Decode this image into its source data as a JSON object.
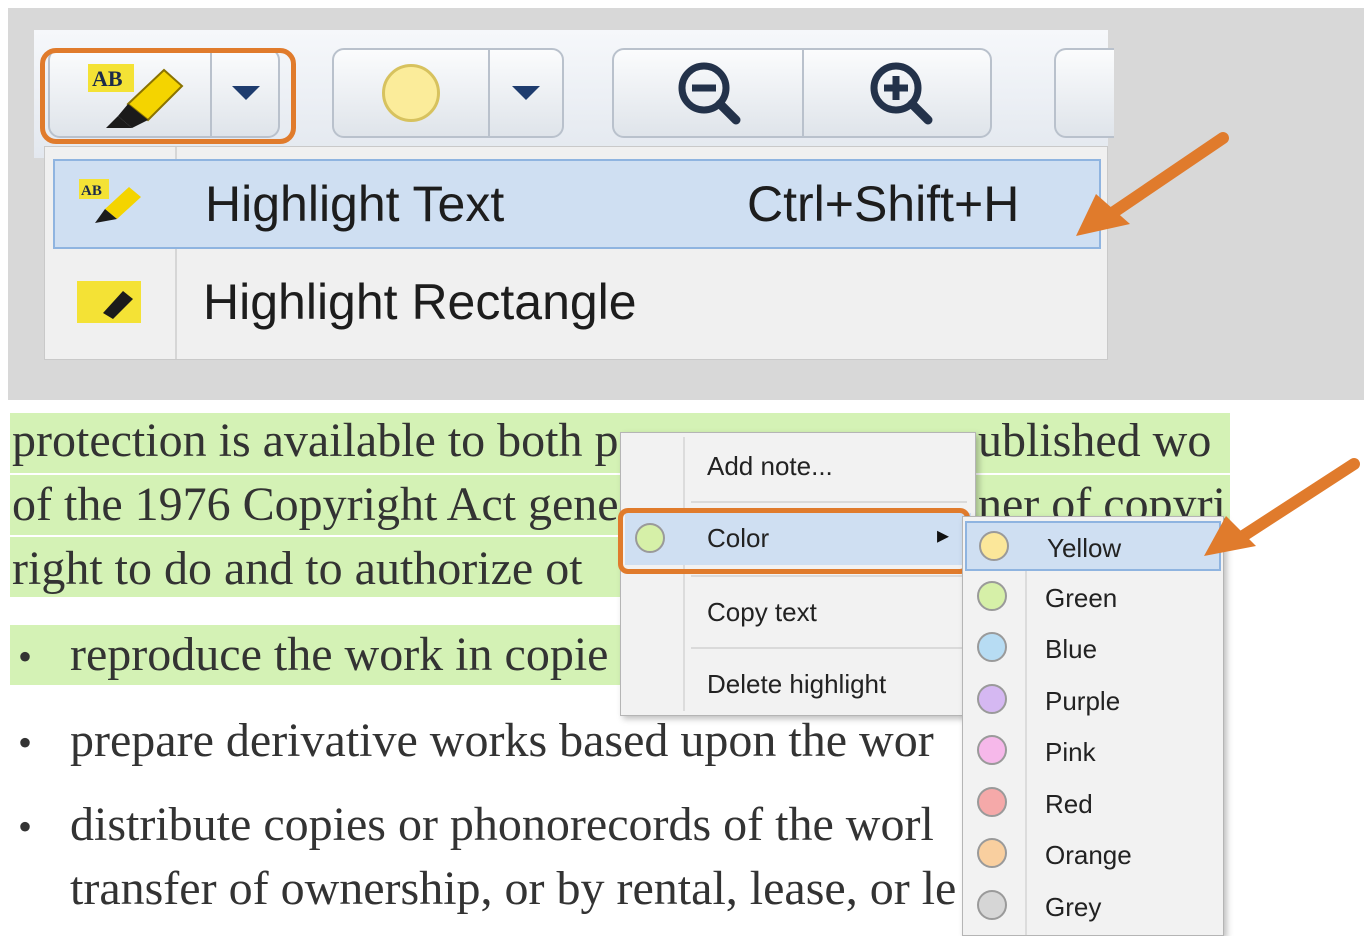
{
  "toolbar": {
    "highlight_button_icon": "highlighter-ab-icon",
    "color_button_icon": "color-circle-icon",
    "zoom_out_icon": "zoom-out-icon",
    "zoom_in_icon": "zoom-in-icon"
  },
  "highlight_menu": {
    "items": [
      {
        "label": "Highlight Text",
        "shortcut": "Ctrl+Shift+H",
        "icon": "highlight-text-icon"
      },
      {
        "label": "Highlight Rectangle",
        "shortcut": "",
        "icon": "highlight-rectangle-icon"
      }
    ]
  },
  "document": {
    "lines": [
      "protection is available to both p",
      "of the 1976 Copyright Act gene",
      "right to do and to authorize ot",
      "reproduce the work in copie",
      "prepare derivative works based upon the wor",
      "distribute copies or phonorecords of the worl",
      "transfer of ownership, or by rental, lease, or le"
    ],
    "right_fragments": [
      "ublished wo",
      "ner of copyri"
    ],
    "bullet": "•"
  },
  "context_menu": {
    "add_note": "Add note...",
    "color": "Color",
    "copy_text": "Copy text",
    "delete_highlight": "Delete highlight",
    "submenu_arrow": "▸"
  },
  "color_submenu": {
    "items": [
      {
        "label": "Yellow",
        "color": "#fbe79a"
      },
      {
        "label": "Green",
        "color": "#d6f0a8"
      },
      {
        "label": "Blue",
        "color": "#b7dcf3"
      },
      {
        "label": "Purple",
        "color": "#d5b8f2"
      },
      {
        "label": "Pink",
        "color": "#f6b8ea"
      },
      {
        "label": "Red",
        "color": "#f5a9a9"
      },
      {
        "label": "Orange",
        "color": "#f9cf9f"
      },
      {
        "label": "Grey",
        "color": "#d6d6d6"
      }
    ]
  },
  "colors": {
    "annotation_orange": "#e07b2c",
    "highlight_green": "#d4f2b5",
    "selection_blue": "#cfdff2"
  }
}
